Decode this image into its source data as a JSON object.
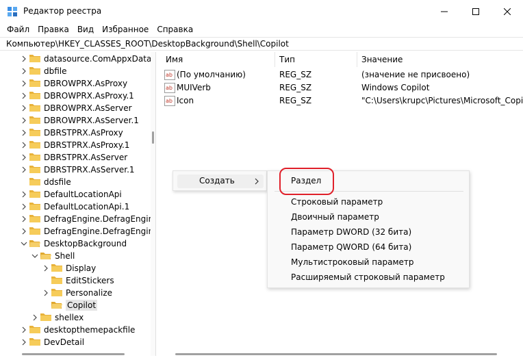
{
  "window": {
    "title": "Редактор реестра"
  },
  "menu": [
    "Файл",
    "Правка",
    "Вид",
    "Избранное",
    "Справка"
  ],
  "address": "Компьютер\\HKEY_CLASSES_ROOT\\DesktopBackground\\Shell\\Copilot",
  "tree": [
    {
      "label": "datasource.ComAppxDataSo",
      "level": 0,
      "expandable": true
    },
    {
      "label": "dbfile",
      "level": 0,
      "expandable": true
    },
    {
      "label": "DBROWPRX.AsProxy",
      "level": 0,
      "expandable": true
    },
    {
      "label": "DBROWPRX.AsProxy.1",
      "level": 0,
      "expandable": true
    },
    {
      "label": "DBROWPRX.AsServer",
      "level": 0,
      "expandable": true
    },
    {
      "label": "DBROWPRX.AsServer.1",
      "level": 0,
      "expandable": true
    },
    {
      "label": "DBRSTPRX.AsProxy",
      "level": 0,
      "expandable": true
    },
    {
      "label": "DBRSTPRX.AsProxy.1",
      "level": 0,
      "expandable": true
    },
    {
      "label": "DBRSTPRX.AsServer",
      "level": 0,
      "expandable": true
    },
    {
      "label": "DBRSTPRX.AsServer.1",
      "level": 0,
      "expandable": true
    },
    {
      "label": "ddsfile",
      "level": 0,
      "expandable": false
    },
    {
      "label": "DefaultLocationApi",
      "level": 0,
      "expandable": true
    },
    {
      "label": "DefaultLocationApi.1",
      "level": 0,
      "expandable": true
    },
    {
      "label": "DefragEngine.DefragEngine",
      "level": 0,
      "expandable": true
    },
    {
      "label": "DefragEngine.DefragEngine.",
      "level": 0,
      "expandable": true
    },
    {
      "label": "DesktopBackground",
      "level": 0,
      "expandable": true,
      "expanded": true
    },
    {
      "label": "Shell",
      "level": 1,
      "expandable": true,
      "expanded": true
    },
    {
      "label": "Display",
      "level": 2,
      "expandable": true
    },
    {
      "label": "EditStickers",
      "level": 2,
      "expandable": false
    },
    {
      "label": "Personalize",
      "level": 2,
      "expandable": true
    },
    {
      "label": "Copilot",
      "level": 2,
      "expandable": false,
      "selected": true
    },
    {
      "label": "shellex",
      "level": 1,
      "expandable": true
    },
    {
      "label": "desktopthemepackfile",
      "level": 0,
      "expandable": true
    },
    {
      "label": "DevDetail",
      "level": 0,
      "expandable": true
    }
  ],
  "columns": {
    "name": "Имя",
    "type": "Тип",
    "value": "Значение"
  },
  "values": [
    {
      "name": "(По умолчанию)",
      "type": "REG_SZ",
      "data": "(значение не присвоено)"
    },
    {
      "name": "MUIVerb",
      "type": "REG_SZ",
      "data": "Windows Copilot"
    },
    {
      "name": "Icon",
      "type": "REG_SZ",
      "data": "\"C:\\Users\\krupc\\Pictures\\Microsoft_Copilot"
    }
  ],
  "context_menu": {
    "create_label": "Создать"
  },
  "submenu": {
    "items": [
      "Раздел",
      "Строковый параметр",
      "Двоичный параметр",
      "Параметр DWORD (32 бита)",
      "Параметр QWORD (64 бита)",
      "Мультистроковый параметр",
      "Расширяемый строковый параметр"
    ]
  },
  "colors": {
    "folder": "#f0c34a",
    "highlight": "#e0202a",
    "selection": "#e5e5e5"
  }
}
